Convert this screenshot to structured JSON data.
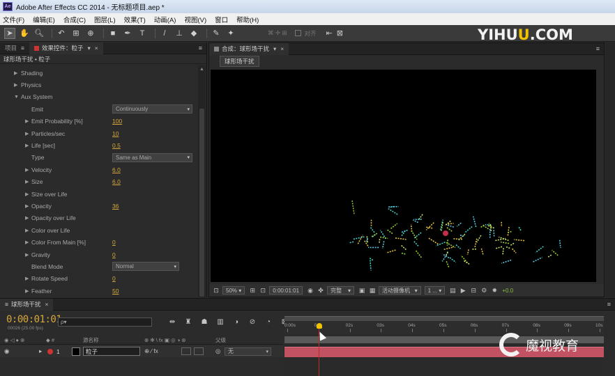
{
  "window": {
    "app_logo": "Ae",
    "title": "Adobe After Effects CC 2014 - 无标题项目.aep *"
  },
  "menu": [
    "文件(F)",
    "编辑(E)",
    "合成(C)",
    "图层(L)",
    "效果(T)",
    "动画(A)",
    "视图(V)",
    "窗口",
    "帮助(H)"
  ],
  "toolbar": {
    "align_label": "对齐",
    "watermark": {
      "left": "YIHU",
      "u": "U",
      "right": ".COM"
    }
  },
  "left_panel": {
    "tab_project": "项目",
    "tab_effects": "效果控件：粒子",
    "header": "球形场干扰 • 粒子",
    "rows": [
      {
        "label": "Shading",
        "type": "group"
      },
      {
        "label": "Physics",
        "type": "group"
      },
      {
        "label": "Aux System",
        "type": "group-open"
      },
      {
        "label": "Emit",
        "type": "dropdown",
        "value": "Continuously"
      },
      {
        "label": "Emit Probability [%]",
        "type": "value",
        "value": "100"
      },
      {
        "label": "Particles/sec",
        "type": "value",
        "value": "10"
      },
      {
        "label": "Life [sec]",
        "type": "value",
        "value": "0.5"
      },
      {
        "label": "Type",
        "type": "dropdown",
        "value": "Same as Main"
      },
      {
        "label": "Velocity",
        "type": "value",
        "value": "6.0"
      },
      {
        "label": "Size",
        "type": "value",
        "value": "6.0"
      },
      {
        "label": "Size over Life",
        "type": "sub"
      },
      {
        "label": "Opacity",
        "type": "value",
        "value": "36"
      },
      {
        "label": "Opacity over Life",
        "type": "sub"
      },
      {
        "label": "Color over Life",
        "type": "sub"
      },
      {
        "label": "Color From Main [%]",
        "type": "value",
        "value": "0"
      },
      {
        "label": "Gravity",
        "type": "value",
        "value": "0"
      },
      {
        "label": "Blend Mode",
        "type": "dropdown",
        "value": "Normal"
      },
      {
        "label": "Rotate Speed",
        "type": "value",
        "value": "0"
      },
      {
        "label": "Feather",
        "type": "value",
        "value": "50"
      }
    ]
  },
  "comp_panel": {
    "tab": "合成：球形场干扰",
    "subtab": "球形场干扰",
    "footer": {
      "zoom": "50%",
      "timecode": "0:00:01:01",
      "resolution": "完整",
      "camera": "活动摄像机",
      "views": "1 ...",
      "exposure": "+0.0"
    }
  },
  "timeline": {
    "tab": "球形场干扰",
    "timecode": "0:00:01:01",
    "fps": "00026 (25.00 fps)",
    "search_placeholder": "ρ▾",
    "ticks": [
      "0:00s",
      "01s",
      "02s",
      "03s",
      "04s",
      "05s",
      "06s",
      "07s",
      "08s",
      "09s",
      "10s"
    ],
    "col_source": "源名称",
    "col_parent": "父级",
    "layer": {
      "number": "1",
      "name": "粒子",
      "parent": "无"
    }
  },
  "watermark_bottom": "魔视教育"
}
